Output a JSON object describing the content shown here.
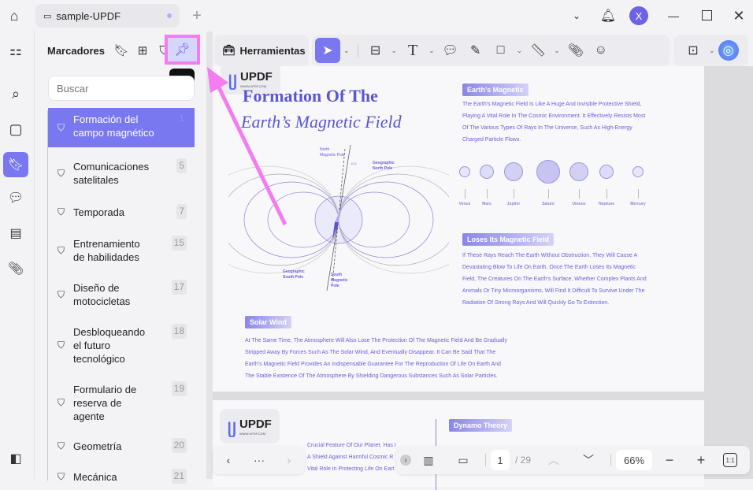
{
  "titlebar": {
    "tab_title": "sample-UPDF",
    "avatar_letter": "X"
  },
  "panel": {
    "title": "Marcadores",
    "tooltip": "Pin",
    "search_placeholder": "Buscar",
    "items": [
      {
        "label": "Formación del\ncampo magnético",
        "page": "1",
        "active": true
      },
      {
        "label": "Comunicaciones\nsatelitales",
        "page": "5"
      },
      {
        "label": "Temporada",
        "page": "7"
      },
      {
        "label": "Entrenamiento\nde habilidades",
        "page": "15"
      },
      {
        "label": "Diseño de\nmotocicletas",
        "page": "17"
      },
      {
        "label": "Desbloqueando\nel futuro\ntecnológico",
        "page": "18"
      },
      {
        "label": "Formulario de\nreserva de\nagente",
        "page": "19"
      },
      {
        "label": "Geometría",
        "page": "20"
      },
      {
        "label": "Mecánica",
        "page": "21"
      }
    ]
  },
  "toolbar": {
    "tools_label": "Herramientas"
  },
  "document": {
    "title_line1": "Formation Of The",
    "title_line2": "Earth’s Magnetic Field",
    "logo_text": "UPDF",
    "logo_url": "WWW.UPDF.COM",
    "diagram_labels": {
      "north_magnetic": "North\nMagnetic Pole",
      "geo_north": "Geographic\nNorth Pole",
      "geo_south": "Geographic\nSouth Pole",
      "south_magnetic": "South\nMagnetic\nPole",
      "angle": "11.5"
    },
    "sec1_title": "Earth's Magnetic",
    "sec1_text": "The Earth's Magnetic Field Is Like A Huge And Invisible Protective Shield,\nPlaying A Vital Role In The Cosmic Environment. It Effectively Resists Most\nOf The Various Types Of Rays In The Universe, Such As High-Energy\nCharged Particle Flows.",
    "planets": [
      "Venus",
      "Mars",
      "Jupiter",
      "Saturn",
      "Uranus",
      "Neptune",
      "Mercury"
    ],
    "sec2_title": "Loses Its Magnetic Field",
    "sec2_text": "If These Rays Reach The Earth Without Obstruction, They Will Cause A\nDevastating Blow To Life On Earth. Once The Earth Loses Its Magnetic\nField, The Creatures On The Earth's Surface, Whether Complex Plants And\nAnimals Or Tiny Microorganisms, Will Find It Difficult To Survive Under The\nRadiation Of Strong Rays And Will Quickly Go To Extinction.",
    "sec3_title": "Solar Wind",
    "sec3_text": "At The Same Time, The Atmosphere Will Also Lose The Protection Of The Magnetic Field And Be Gradually\nStripped Away By Forces Such As The Solar Wind, And Eventually Disappear. It Can Be Said That The\nEarth's Magnetic Field Provides An Indispensable Guarantee For The Reproduction Of Life On Earth And\nThe Stable Existence Of The Atmosphere By Shielding Dangerous Substances Such As Solar Particles.",
    "page2_text": "Crucial Feature Of Our Planet, Has I\nA Shield Against Harmful Cosmic R\nVital Role In Protecting Life On Eart",
    "sec4_title": "Dynamo Theory"
  },
  "nav": {
    "more": "···",
    "page_current": "1",
    "page_total": "/ 29",
    "zoom": "66%",
    "fit_label": "1:1"
  },
  "colors": {
    "accent": "#7a78f0",
    "highlight": "#f37df0"
  }
}
